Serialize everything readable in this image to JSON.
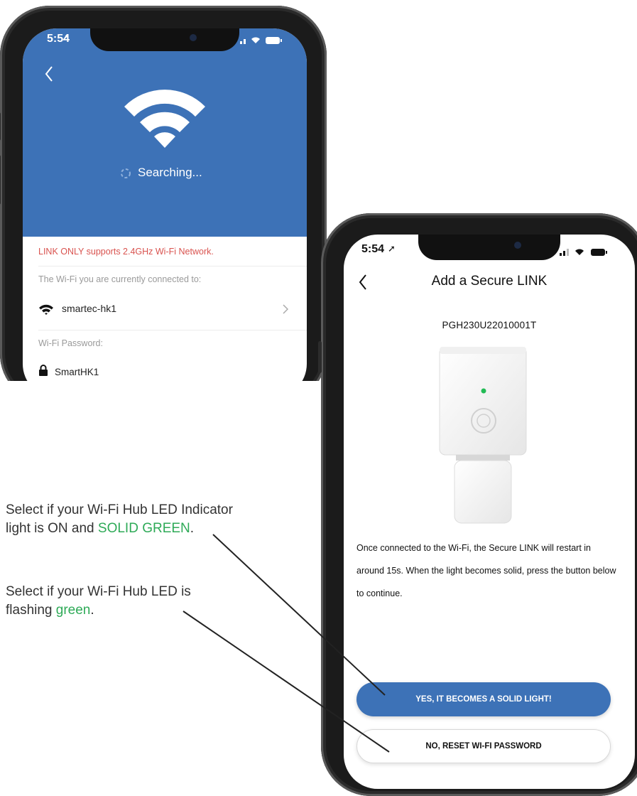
{
  "colors": {
    "brand_blue": "#3d72b7",
    "warning_red": "#d9534f",
    "annotation_green": "#2eaa57",
    "led_green": "#22bb55"
  },
  "phone_left": {
    "status_time": "5:54",
    "back_icon": "chevron-left-icon",
    "wifi_icon": "wifi-icon",
    "searching_text": "Searching...",
    "warning_text": "LINK ONLY supports 2.4GHz Wi-Fi Network.",
    "current_wifi_label": "The Wi-Fi you are currently connected to:",
    "network_name": "smartec-hk1",
    "password_label": "Wi-Fi Password:",
    "password_value": "SmartHK1"
  },
  "phone_right": {
    "status_time": "5:54",
    "title": "Add a Secure LINK",
    "serial_number": "PGH230U22010001T",
    "description": "Once connected to the Wi-Fi, the Secure LINK will restart in around 15s. When the light becomes solid, press the button below to continue.",
    "primary_button": "YES, IT BECOMES A SOLID LIGHT!",
    "secondary_button": "NO, RESET WI-FI PASSWORD"
  },
  "annotations": {
    "solid": {
      "prefix": "Select if your Wi-Fi Hub LED Indicator light is ON and",
      "highlight": "SOLID GREEN",
      "suffix": "."
    },
    "flashing": {
      "prefix": "Select if your Wi-Fi Hub LED is flashing",
      "highlight": "green",
      "suffix": "."
    }
  }
}
